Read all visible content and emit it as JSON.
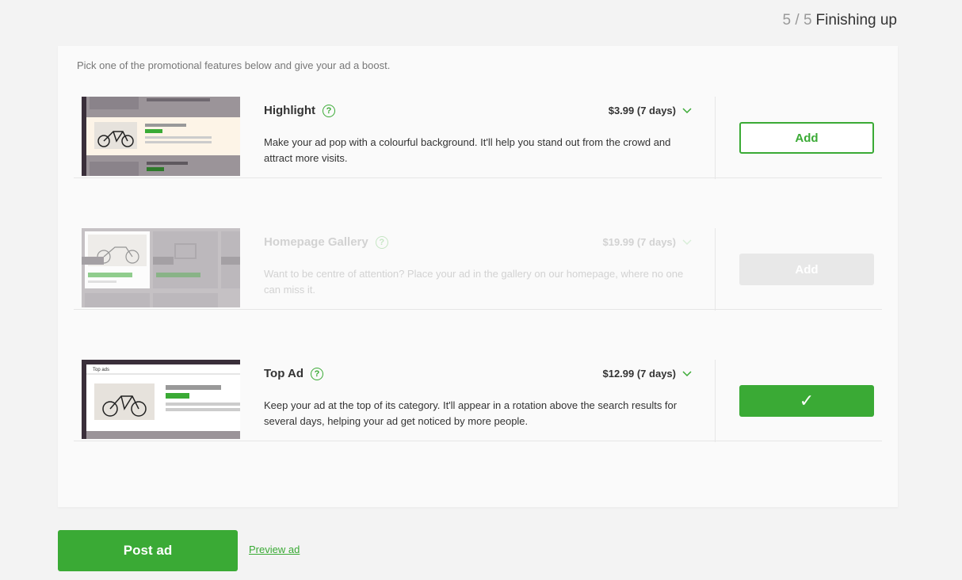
{
  "header": {
    "step_current": "5",
    "step_separator": "/",
    "step_total": "5",
    "step_label": "Finishing up"
  },
  "intro": "Pick one of the promotional features below and give your ad a boost.",
  "features": [
    {
      "name": "Highlight",
      "price": "$3.99 (7 days)",
      "description": "Make your ad pop with a colourful background. It'll help you stand out from the crowd and attract more visits.",
      "button_label": "Add",
      "state": "available"
    },
    {
      "name": "Homepage Gallery",
      "price": "$19.99 (7 days)",
      "description": "Want to be centre of attention? Place your ad in the gallery on our homepage, where no one can miss it.",
      "button_label": "Add",
      "state": "disabled"
    },
    {
      "name": "Top Ad",
      "thumb_label": "Top ads",
      "price": "$12.99 (7 days)",
      "description": "Keep your ad at the top of its category. It'll appear in a rotation above the search results for several days, helping your ad get noticed by more people.",
      "button_label": "✓",
      "state": "selected"
    }
  ],
  "icons": {
    "help": "?",
    "chevron": "chevron-down-icon",
    "check": "checkmark-icon"
  },
  "footer": {
    "post_label": "Post ad",
    "preview_label": "Preview ad"
  },
  "colors": {
    "accent": "#3aaa35",
    "background": "#f3f3f3",
    "card": "#fafafa"
  }
}
